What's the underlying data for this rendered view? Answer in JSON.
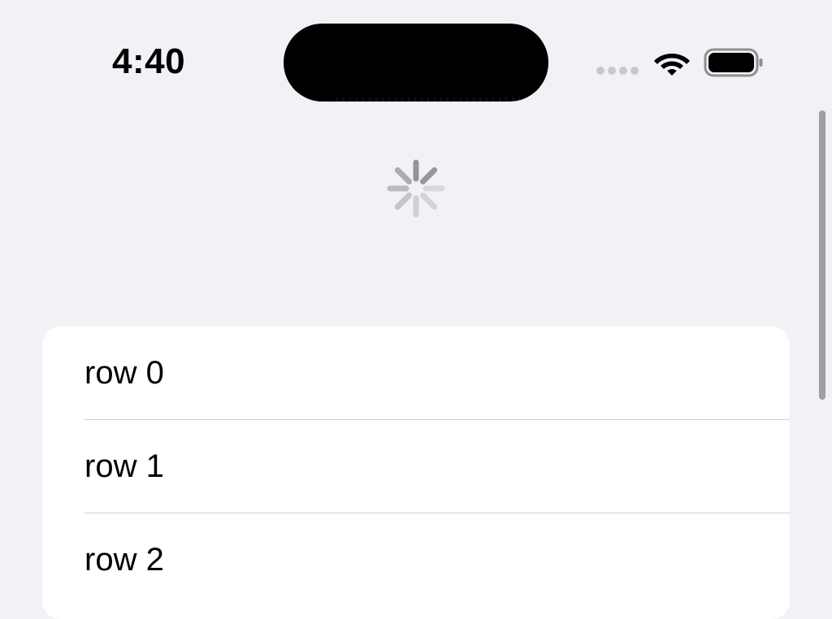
{
  "status_bar": {
    "time": "4:40",
    "icons": [
      "signal-dots-icon",
      "wifi-icon",
      "battery-icon"
    ]
  },
  "refresh": {
    "icon": "activity-spinner-icon"
  },
  "list": {
    "rows": [
      {
        "label": "row 0"
      },
      {
        "label": "row 1"
      },
      {
        "label": "row 2"
      }
    ]
  },
  "colors": {
    "background": "#f2f1f6",
    "card": "#ffffff",
    "separator": "#d1d1d6",
    "spinner": "#8e8e93"
  }
}
